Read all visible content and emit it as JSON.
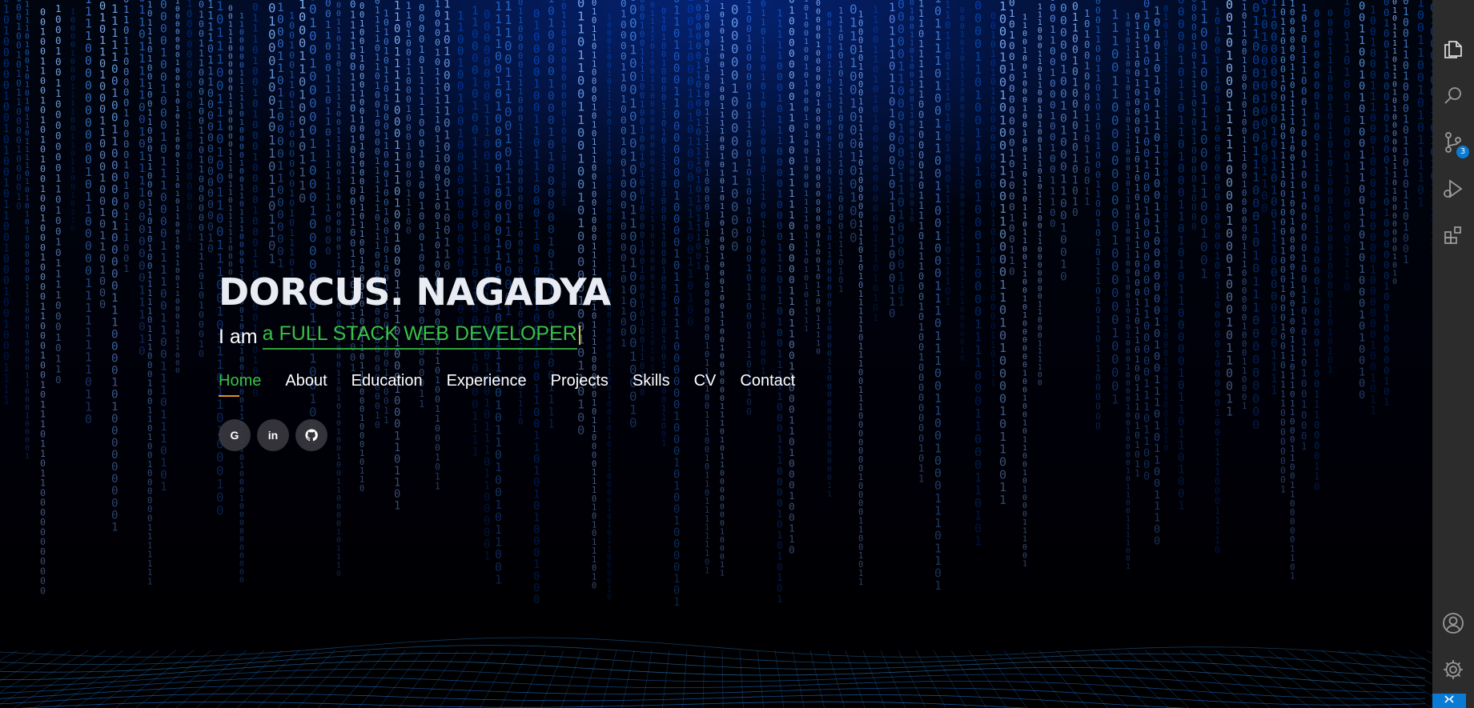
{
  "hero": {
    "name": "DORCUS. NAGADYA",
    "typed_prefix": "I am",
    "typed_text": "a FULL STACK WEB DEVELOPER"
  },
  "nav": {
    "items": [
      {
        "label": "Home",
        "active": true
      },
      {
        "label": "About",
        "active": false
      },
      {
        "label": "Education",
        "active": false
      },
      {
        "label": "Experience",
        "active": false
      },
      {
        "label": "Projects",
        "active": false
      },
      {
        "label": "Skills",
        "active": false
      },
      {
        "label": "CV",
        "active": false
      },
      {
        "label": "Contact",
        "active": false
      }
    ]
  },
  "socials": [
    {
      "label": "G",
      "icon": "google-icon"
    },
    {
      "label": "in",
      "icon": "linkedin-icon"
    },
    {
      "label": "",
      "icon": "github-icon"
    }
  ],
  "activity_bar": {
    "icons": [
      "explorer-icon",
      "search-icon",
      "source-control-icon",
      "run-debug-icon",
      "extensions-icon",
      "account-icon",
      "settings-icon",
      "remote-icon"
    ],
    "source_control_badge": "3"
  },
  "colors": {
    "accent_green": "#37c244",
    "nav_underline": "#e0902a",
    "rain_blue": "#1f6bff",
    "activity_bar_bg": "#2c2c2c",
    "badge_blue": "#0a7bd4"
  }
}
